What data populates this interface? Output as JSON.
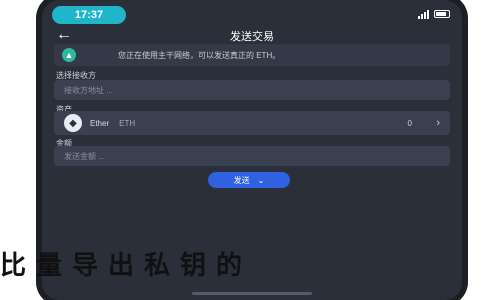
{
  "status_bar": {
    "time": "17:37"
  },
  "nav": {
    "title": "发送交易"
  },
  "notice": {
    "icon": "warning-icon",
    "text": "您正在使用主干网络，可以发送真正的 ETH。"
  },
  "receiver": {
    "label": "选择接收方",
    "placeholder": "接收方地址 ..."
  },
  "asset": {
    "label": "资产",
    "name": "Ether",
    "symbol": "ETH",
    "balance": "0",
    "icon": "ethereum-icon"
  },
  "amount": {
    "label": "金额",
    "placeholder": "发送金额 ..."
  },
  "send_button": {
    "label": "发送"
  },
  "banner": {
    "text": "比量导出私钥的"
  }
}
